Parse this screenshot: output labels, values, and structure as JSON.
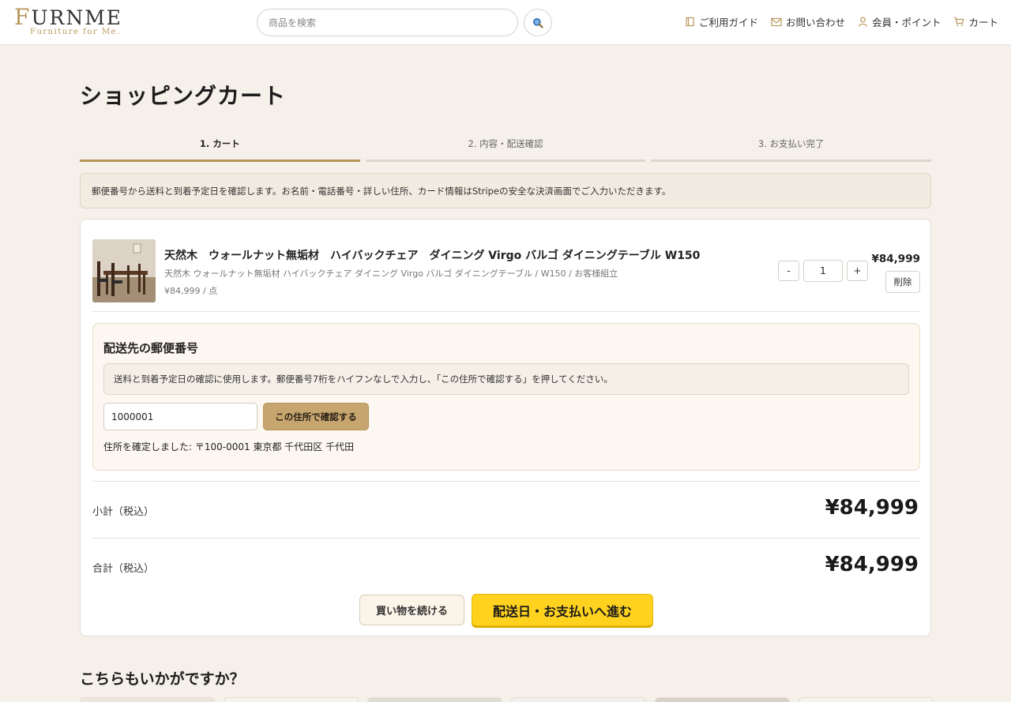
{
  "header": {
    "logo_main": "URNME",
    "logo_initial": "F",
    "logo_sub": "Furniture for Me.",
    "search_placeholder": "商品を検索",
    "nav": [
      {
        "label": "ご利用ガイド",
        "icon": "guide-icon"
      },
      {
        "label": "お問い合わせ",
        "icon": "mail-icon"
      },
      {
        "label": "会員・ポイント",
        "icon": "user-icon"
      },
      {
        "label": "カート",
        "icon": "cart-icon"
      }
    ]
  },
  "page_title": "ショッピングカート",
  "steps": [
    {
      "label": "1. カート",
      "active": true
    },
    {
      "label": "2. 内容・配送確認",
      "active": false
    },
    {
      "label": "3. お支払い完了",
      "active": false
    }
  ],
  "notice": "郵便番号から送料と到着予定日を確認します。お名前・電話番号・詳しい住所、カード情報はStripeの安全な決済画面でご入力いただきます。",
  "cart_item": {
    "name": "天然木　ウォールナット無垢材　ハイバックチェア　ダイニング Virgo バルゴ ダイニングテーブル W150",
    "variant": "天然木 ウォールナット無垢材 ハイバックチェア ダイニング Virgo バルゴ ダイニングテーブル / W150 / お客様組立",
    "unit_price": "¥84,999 / 点",
    "quantity": "1",
    "minus_label": "-",
    "plus_label": "+",
    "price": "¥84,999",
    "delete_label": "削除"
  },
  "postal": {
    "title": "配送先の郵便番号",
    "help": "送料と到着予定日の確認に使用します。郵便番号7桁をハイフンなしで入力し、「この住所で確認する」を押してください。",
    "value": "1000001",
    "confirm_label": "この住所で確認する",
    "status": "住所を確定しました: 〒100-0001 東京都 千代田区 千代田"
  },
  "totals": {
    "subtotal_label": "小計（税込）",
    "subtotal_value": "¥84,999",
    "total_label": "合計（税込）",
    "total_value": "¥84,999"
  },
  "actions": {
    "continue_label": "買い物を続ける",
    "proceed_label": "配送日・お支払いへ進む"
  },
  "recommend_title": "こちらもいかがですか？",
  "colors": {
    "accent": "#b8965a",
    "cta": "#ffd21f",
    "background": "#f5f0e9"
  }
}
